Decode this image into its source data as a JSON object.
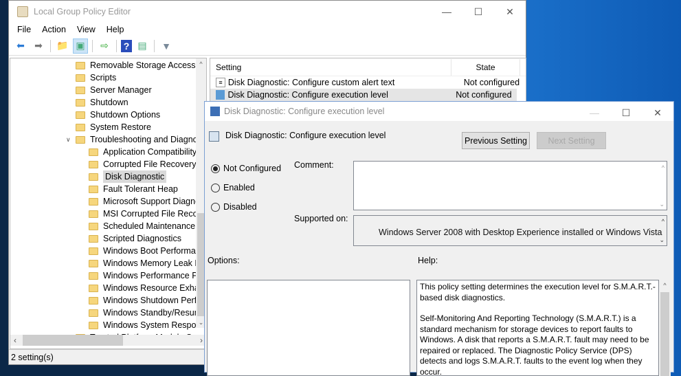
{
  "main_window": {
    "title": "Local Group Policy Editor",
    "menu": [
      "File",
      "Action",
      "View",
      "Help"
    ],
    "toolbar_icons": [
      "back-arrow-icon",
      "forward-arrow-icon",
      "up-folder-icon",
      "show-hide-tree-icon",
      "export-list-icon",
      "help-icon",
      "action-pane-icon",
      "filter-icon"
    ],
    "tree": [
      {
        "label": "Removable Storage Access",
        "level": 1
      },
      {
        "label": "Scripts",
        "level": 1
      },
      {
        "label": "Server Manager",
        "level": 1
      },
      {
        "label": "Shutdown",
        "level": 1
      },
      {
        "label": "Shutdown Options",
        "level": 1
      },
      {
        "label": "System Restore",
        "level": 1
      },
      {
        "label": "Troubleshooting and Diagnostic",
        "level": 1,
        "expanded": true
      },
      {
        "label": "Application Compatibility D",
        "level": 2
      },
      {
        "label": "Corrupted File Recovery",
        "level": 2
      },
      {
        "label": "Disk Diagnostic",
        "level": 2,
        "selected": true
      },
      {
        "label": "Fault Tolerant Heap",
        "level": 2
      },
      {
        "label": "Microsoft Support Diagnosti",
        "level": 2
      },
      {
        "label": "MSI Corrupted File Recovery",
        "level": 2
      },
      {
        "label": "Scheduled Maintenance",
        "level": 2
      },
      {
        "label": "Scripted Diagnostics",
        "level": 2
      },
      {
        "label": "Windows Boot Performance",
        "level": 2
      },
      {
        "label": "Windows Memory Leak Diag",
        "level": 2
      },
      {
        "label": "Windows Performance PerfT",
        "level": 2
      },
      {
        "label": "Windows Resource Exhaustio",
        "level": 2
      },
      {
        "label": "Windows Shutdown Perform",
        "level": 2
      },
      {
        "label": "Windows Standby/Resume F",
        "level": 2
      },
      {
        "label": "Windows System Responsive",
        "level": 2
      },
      {
        "label": "Trusted Platform Module Servic",
        "level": 1
      }
    ],
    "list": {
      "headers": {
        "setting": "Setting",
        "state": "State"
      },
      "rows": [
        {
          "setting": "Disk Diagnostic: Configure custom alert text",
          "state": "Not configured"
        },
        {
          "setting": "Disk Diagnostic: Configure execution level",
          "state": "Not configured",
          "selected": true
        }
      ]
    },
    "status": "2 setting(s)"
  },
  "dialog": {
    "title": "Disk Diagnostic: Configure execution level",
    "heading": "Disk Diagnostic: Configure execution level",
    "prev_button": "Previous Setting",
    "next_button": "Next Setting",
    "radios": [
      {
        "label": "Not Configured",
        "checked": true
      },
      {
        "label": "Enabled",
        "checked": false
      },
      {
        "label": "Disabled",
        "checked": false
      }
    ],
    "comment_label": "Comment:",
    "comment_value": "",
    "supported_label": "Supported on:",
    "supported_value": "Windows Server 2008 with Desktop Experience installed or Windows Vista",
    "options_label": "Options:",
    "help_label": "Help:",
    "help_paragraphs": [
      "This policy setting determines the execution level for S.M.A.R.T.-based disk diagnostics.",
      "Self-Monitoring And Reporting Technology (S.M.A.R.T.) is a standard mechanism for storage devices to report faults to Windows. A disk that reports a S.M.A.R.T. fault may need to be repaired or replaced. The Diagnostic Policy Service (DPS) detects and logs S.M.A.R.T. faults to the event log when they occur."
    ]
  }
}
